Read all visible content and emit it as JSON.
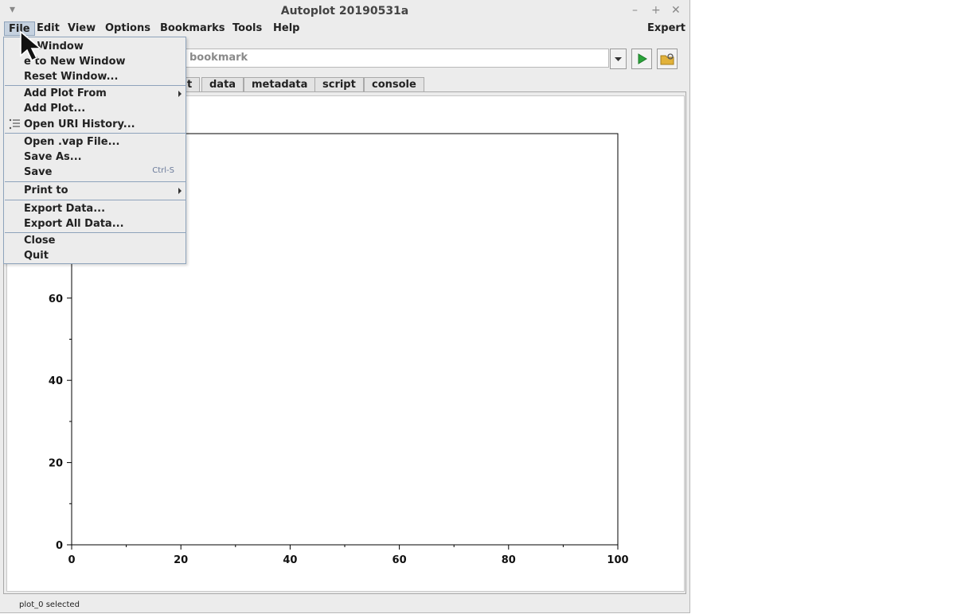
{
  "window": {
    "title": "Autoplot 20190531a",
    "controls": {
      "minimize": "–",
      "maximize": "+",
      "close": "✕"
    }
  },
  "menubar": {
    "items": [
      "File",
      "Edit",
      "View",
      "Options",
      "Bookmarks",
      "Tools",
      "Help"
    ],
    "right_label": "Expert"
  },
  "toolbar": {
    "uri_placeholder": "bookmark",
    "icons": {
      "dropdown": "chevron-down-icon",
      "go": "play-icon",
      "browse": "folder-open-icon"
    }
  },
  "tabs": [
    "t",
    "data",
    "metadata",
    "script",
    "console"
  ],
  "file_menu": {
    "items": [
      {
        "label": "w Window"
      },
      {
        "label": "e to New Window"
      },
      {
        "label": "Reset Window..."
      },
      {
        "label": "Add Plot From",
        "submenu": true
      },
      {
        "label": "Add Plot..."
      },
      {
        "label": "Open URI History...",
        "icon": "history-list-icon"
      },
      {
        "label": "Open .vap File..."
      },
      {
        "label": "Save As..."
      },
      {
        "label": "Save",
        "shortcut": "Ctrl-S"
      },
      {
        "label": "Print to",
        "submenu": true
      },
      {
        "label": "Export Data..."
      },
      {
        "label": "Export All Data..."
      },
      {
        "label": "Close"
      },
      {
        "label": "Quit"
      }
    ]
  },
  "chart_data": {
    "type": "line",
    "series": [],
    "xlim": [
      0,
      100
    ],
    "ylim": [
      0,
      100
    ],
    "x_ticks": [
      "0",
      "20",
      "40",
      "60",
      "80",
      "100"
    ],
    "y_ticks": [
      "0",
      "20",
      "40",
      "60"
    ],
    "xlabel": "",
    "ylabel": "",
    "grid": false
  },
  "status": {
    "text": "plot_0 selected"
  },
  "colors": {
    "menu_highlight": "#c5d1df",
    "menu_border": "#8ea3bb",
    "go_green": "#2aa33a",
    "folder_yellow": "#e2b23a"
  }
}
